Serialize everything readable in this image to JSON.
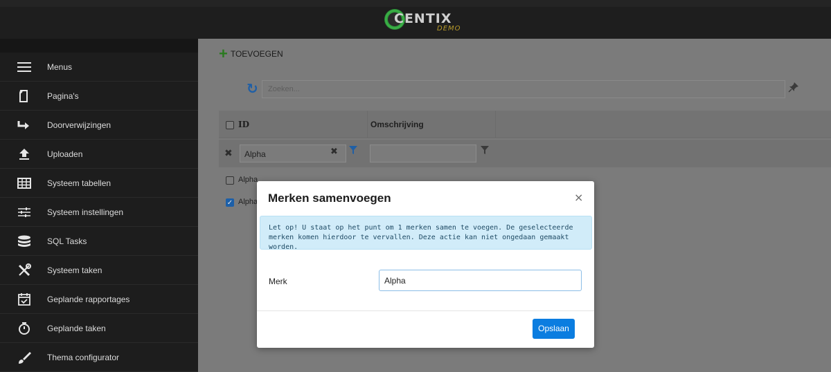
{
  "header": {
    "logo_text": "CENTIX",
    "logo_sub": "DEMO"
  },
  "sidebar": {
    "items": [
      {
        "label": "Menus",
        "icon": "hamburger-icon"
      },
      {
        "label": "Pagina's",
        "icon": "page-icon"
      },
      {
        "label": "Doorverwijzingen",
        "icon": "redirect-arrow-icon"
      },
      {
        "label": "Uploaden",
        "icon": "upload-icon"
      },
      {
        "label": "Systeem tabellen",
        "icon": "table-icon"
      },
      {
        "label": "Systeem instellingen",
        "icon": "sliders-icon"
      },
      {
        "label": "SQL Tasks",
        "icon": "database-icon"
      },
      {
        "label": "Systeem taken",
        "icon": "tools-icon"
      },
      {
        "label": "Geplande rapportages",
        "icon": "calendar-check-icon"
      },
      {
        "label": "Geplande taken",
        "icon": "stopwatch-icon"
      },
      {
        "label": "Thema configurator",
        "icon": "brush-icon"
      }
    ]
  },
  "toolbar": {
    "add_label": "TOEVOEGEN"
  },
  "search": {
    "placeholder": "Zoeken..."
  },
  "grid": {
    "columns": [
      "ID",
      "Omschrijving"
    ],
    "filter_value": "Alpha",
    "rows": [
      {
        "id": "Alpha",
        "checked": false
      },
      {
        "id": "Alpha",
        "checked": true
      }
    ]
  },
  "modal": {
    "title": "Merken samenvoegen",
    "close": "×",
    "alert": "Let op! U staat op het punt om 1 merken samen te voegen. De geselecteerde merken komen hierdoor te vervallen. Deze actie kan niet ongedaan gemaakt worden.",
    "field_label": "Merk",
    "field_value": "Alpha",
    "save_label": "Opslaan"
  },
  "colors": {
    "accent": "#0b7de0",
    "add_green": "#2a7a1f",
    "alert_bg": "#d1ecf9"
  }
}
